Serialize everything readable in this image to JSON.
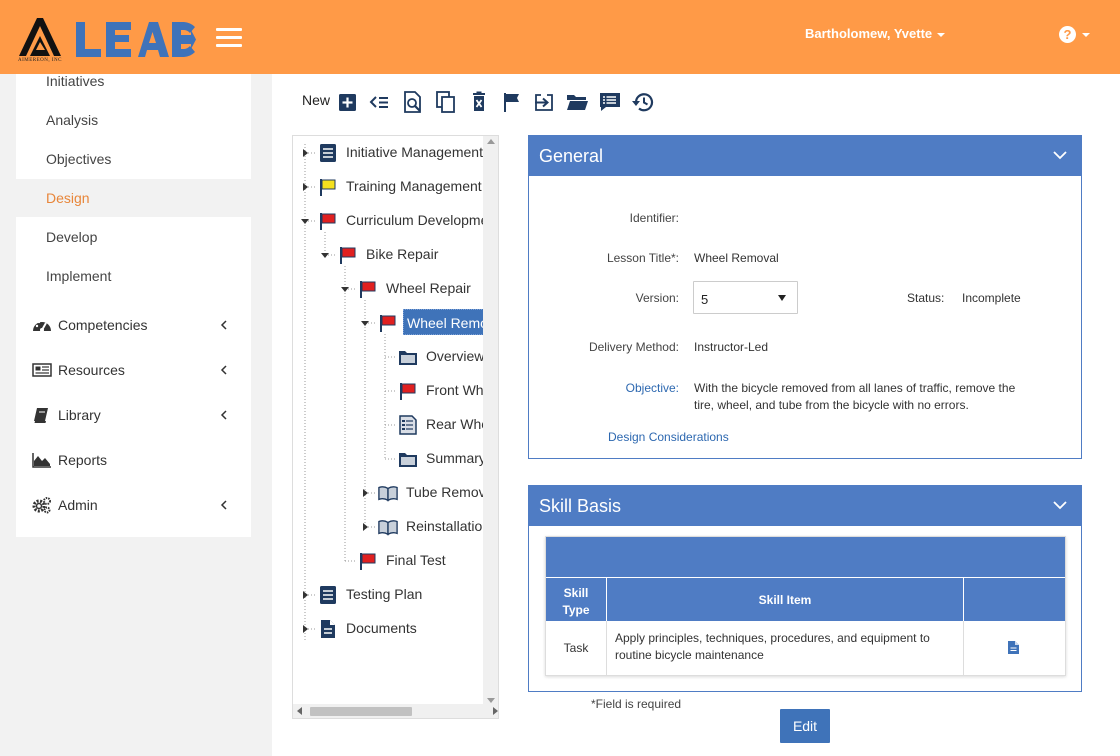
{
  "header": {
    "logo_text": "LEAD",
    "logo_company": "AIMEREON, INC",
    "user_name": "Bartholomew, Yvette",
    "help_symbol": "?",
    "colors": {
      "header_bg": "#ff9a47",
      "brand_blue": "#3f73b9",
      "accent_orange": "#e8863a"
    }
  },
  "sidebar": {
    "sub_items": [
      {
        "label": "Initiatives"
      },
      {
        "label": "Analysis"
      },
      {
        "label": "Objectives"
      },
      {
        "label": "Design",
        "active": true
      },
      {
        "label": "Develop"
      },
      {
        "label": "Implement"
      }
    ],
    "main_items": [
      {
        "label": "Competencies",
        "icon": "dashboard-icon"
      },
      {
        "label": "Resources",
        "icon": "newspaper-icon"
      },
      {
        "label": "Library",
        "icon": "book-icon"
      },
      {
        "label": "Reports",
        "icon": "area-chart-icon"
      },
      {
        "label": "Admin",
        "icon": "gears-icon"
      }
    ]
  },
  "toolbar": {
    "new_label": "New",
    "buttons": [
      "add-icon",
      "indent-list-icon",
      "search-document-icon",
      "copy-icon",
      "delete-icon",
      "flag-icon",
      "export-icon",
      "open-folder-icon",
      "comment-list-icon",
      "history-icon"
    ]
  },
  "tree": {
    "nodes": [
      {
        "label": "Initiative Management",
        "icon": "document-icon"
      },
      {
        "label": "Training Management Doc",
        "icon": "yellow-flag-icon"
      },
      {
        "label": "Curriculum Development",
        "icon": "red-flag-icon"
      },
      {
        "label": "Bike Repair",
        "icon": "red-flag-icon"
      },
      {
        "label": "Wheel Repair",
        "icon": "red-flag-icon"
      },
      {
        "label": "Wheel Removal",
        "icon": "red-flag-icon",
        "selected": true
      },
      {
        "label": "Overview",
        "icon": "folder-icon"
      },
      {
        "label": "Front Wheel",
        "icon": "red-flag-icon"
      },
      {
        "label": "Rear Wheel",
        "icon": "form-icon"
      },
      {
        "label": "Summary",
        "icon": "folder-icon"
      },
      {
        "label": "Tube Removal a",
        "icon": "book-icon"
      },
      {
        "label": "Reinstallation of",
        "icon": "book-icon"
      },
      {
        "label": "Final Test",
        "icon": "red-flag-icon"
      },
      {
        "label": "Testing Plan",
        "icon": "document-icon"
      },
      {
        "label": "Documents",
        "icon": "file-icon"
      }
    ]
  },
  "general": {
    "title": "General",
    "identifier_label": "Identifier:",
    "identifier_value": "",
    "lesson_title_label": "Lesson Title*:",
    "lesson_title_value": "Wheel Removal",
    "version_label": "Version:",
    "version_value": "5",
    "status_label": "Status:",
    "status_value": "Incomplete",
    "delivery_label": "Delivery Method:",
    "delivery_value": "Instructor-Led",
    "objective_label": "Objective:",
    "objective_line1": "With the bicycle removed from all lanes of traffic, remove the",
    "objective_line2": "tire, wheel, and tube from the bicycle with no errors.",
    "design_considerations": "Design Considerations"
  },
  "skill_basis": {
    "title": "Skill Basis",
    "col_type_1": "Skill",
    "col_type_2": "Type",
    "col_item": "Skill Item",
    "rows": [
      {
        "type": "Task",
        "item_line1": "Apply principles, techniques, procedures, and equipment to",
        "item_line2": "routine bicycle maintenance"
      }
    ]
  },
  "footer": {
    "required_note": "*Field is required",
    "edit_label": "Edit"
  }
}
